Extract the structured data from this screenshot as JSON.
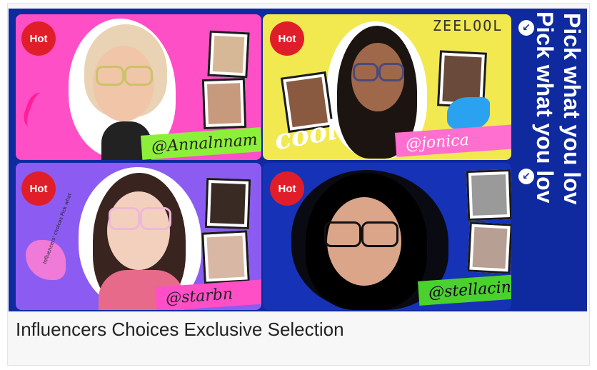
{
  "banner": {
    "logo": "ZEELOOL",
    "hot_badge": "Hot",
    "side_text_1": "Pick what you lov",
    "side_text_2": "Pick what you lov",
    "panels": [
      {
        "handle": "@Annalnnam",
        "bg": "#ff4fc7",
        "handle_bg": "#8cf03a"
      },
      {
        "handle": "@jonica",
        "bg": "#f2e84f",
        "handle_bg": "#ff6fcf"
      },
      {
        "handle": "@starbn",
        "bg": "#8c5cf2",
        "handle_bg": "#ff4fc7"
      },
      {
        "handle": "@stellacini",
        "bg": "#1632b7",
        "handle_bg": "#4bd12e"
      }
    ],
    "cool_text": "cool",
    "small_text": "Influencers' choices  Pick what"
  },
  "caption": "Influencers Choices Exclusive Selection",
  "colors": {
    "accent": "#e01e2a",
    "navy": "#0f2a9e"
  }
}
